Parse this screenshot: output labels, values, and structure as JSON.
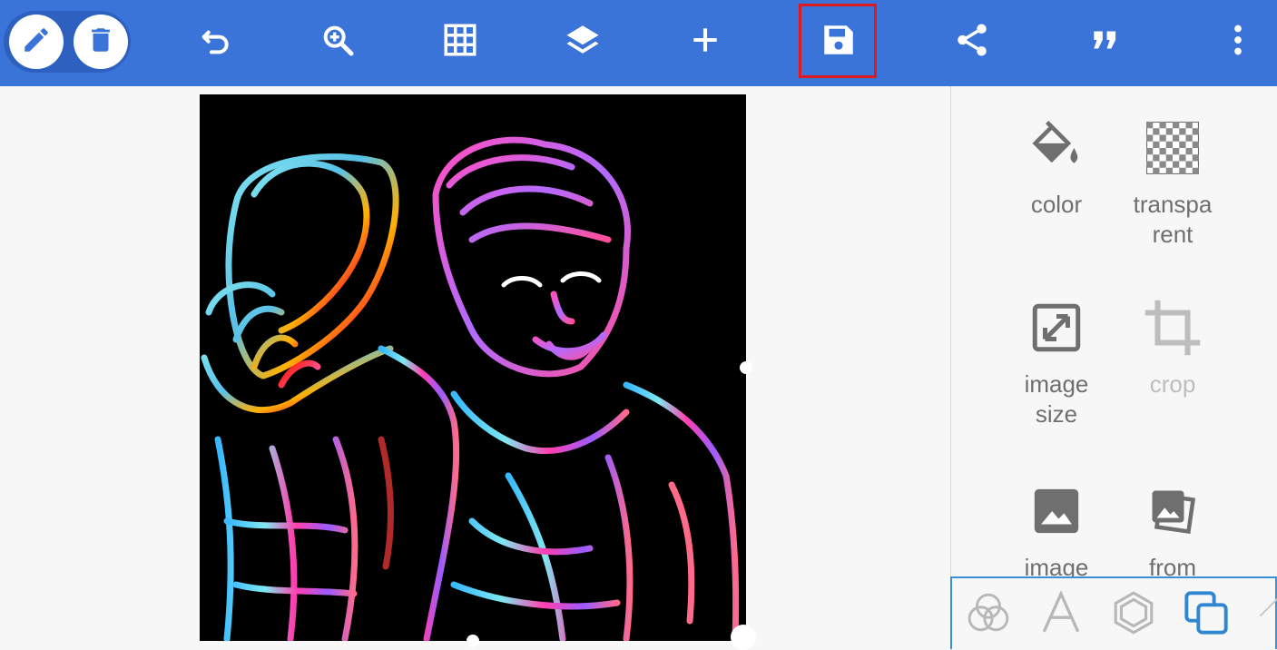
{
  "toolbar": {
    "tools": [
      {
        "name": "pencil-icon"
      },
      {
        "name": "trash-icon"
      },
      {
        "name": "undo-icon"
      },
      {
        "name": "zoom-in-icon"
      },
      {
        "name": "grid-icon"
      },
      {
        "name": "layers-icon"
      },
      {
        "name": "add-icon"
      },
      {
        "name": "save-icon",
        "highlighted": true
      },
      {
        "name": "share-icon"
      },
      {
        "name": "quote-icon"
      },
      {
        "name": "more-vertical-icon"
      }
    ],
    "colors": {
      "bar": "#3b74d9",
      "highlight": "#e0191f"
    }
  },
  "side_panel": {
    "items": [
      {
        "label": "color",
        "icon": "paint-bucket-icon"
      },
      {
        "label": "transpa\nrent",
        "icon": "transparency-icon"
      },
      {
        "label": "image\nsize",
        "icon": "resize-icon"
      },
      {
        "label": "crop",
        "icon": "crop-icon",
        "disabled": true
      },
      {
        "label": "image",
        "icon": "image-icon"
      },
      {
        "label": "from",
        "icon": "photo-stack-icon"
      }
    ]
  },
  "bottom_tabs": [
    {
      "icon": "blend-circles-icon"
    },
    {
      "icon": "text-icon"
    },
    {
      "icon": "shape-hexagon-icon"
    },
    {
      "icon": "layers-squares-icon",
      "active": true
    }
  ]
}
